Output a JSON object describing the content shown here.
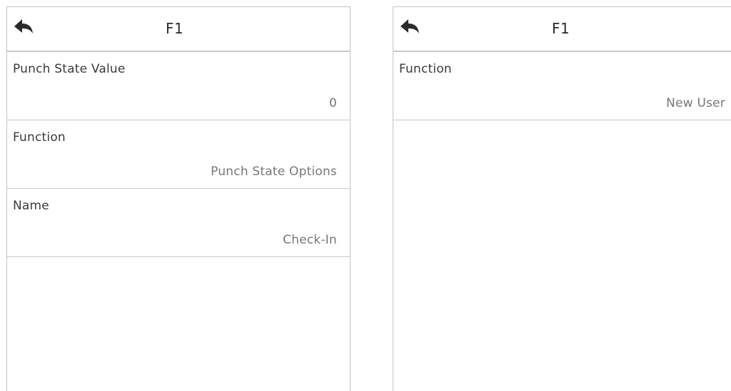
{
  "left_screen": {
    "title": "F1",
    "back_icon": "back-arrow-icon",
    "items": [
      {
        "label": "Punch State Value",
        "value": "0"
      },
      {
        "label": "Function",
        "value": "Punch State Options"
      },
      {
        "label": "Name",
        "value": "Check-In"
      }
    ]
  },
  "right_screen": {
    "title": "F1",
    "back_icon": "back-arrow-icon",
    "items": [
      {
        "label": "Function",
        "value": "New User"
      }
    ]
  }
}
